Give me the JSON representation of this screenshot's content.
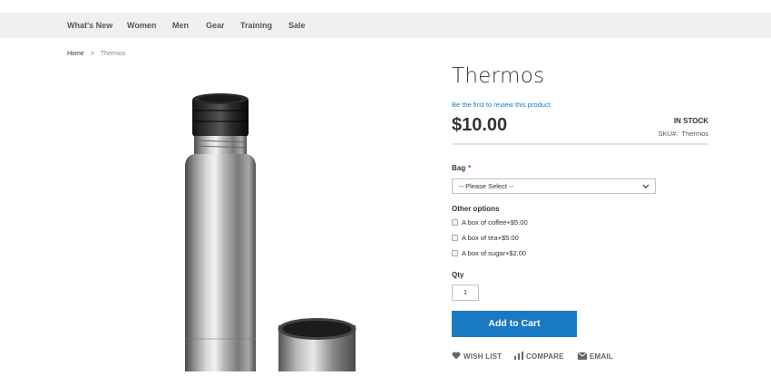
{
  "nav": {
    "items": [
      "What's New",
      "Women",
      "Men",
      "Gear",
      "Training",
      "Sale"
    ]
  },
  "breadcrumb": {
    "home": "Home",
    "separator": ">",
    "current": "Thermos"
  },
  "product": {
    "title": "Thermos",
    "review_link": "Be the first to review this product",
    "price": "$10.00",
    "stock": "IN STOCK",
    "sku_label": "SKU#:",
    "sku_value": "Thermos"
  },
  "options": {
    "bag_label": "Bag",
    "required_marker": "*",
    "bag_select_value": "-- Please Select --",
    "other_label": "Other options",
    "checkboxes": [
      {
        "label": "A box of coffee+$5.00",
        "checked": false
      },
      {
        "label": "A box of tea+$5.00",
        "checked": false
      },
      {
        "label": "A box of sugar+$2.00",
        "checked": false
      }
    ]
  },
  "qty": {
    "label": "Qty",
    "value": "1"
  },
  "cart": {
    "button_label": "Add to Cart"
  },
  "actions": {
    "wishlist": "WISH LIST",
    "compare": "COMPARE",
    "email": "EMAIL"
  },
  "colors": {
    "accent": "#1979c3",
    "required": "#e02b27",
    "nav_bg": "#f0f0f0"
  }
}
